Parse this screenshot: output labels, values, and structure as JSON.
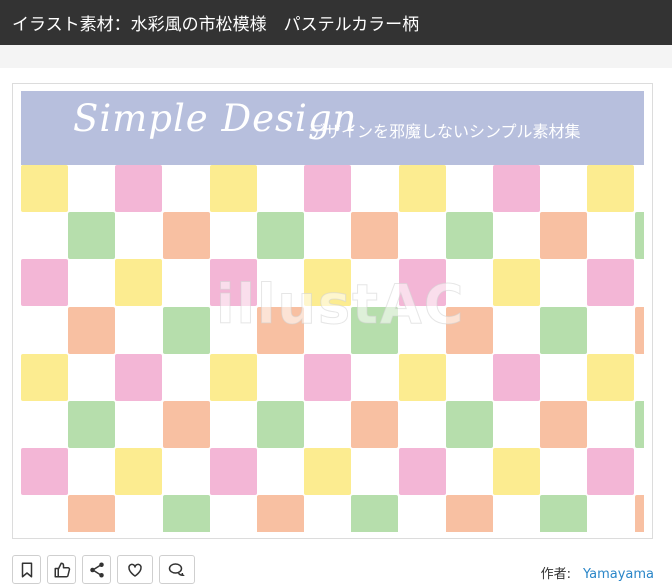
{
  "header": {
    "title": "イラスト素材：水彩風の市松模様　パステルカラー柄"
  },
  "artwork": {
    "banner_title": "Simple Design",
    "banner_subtitle": "デザインを邪魔しないシンプル素材集",
    "banner_color": "#b7bfdd",
    "watermark": "illustAC",
    "palette": {
      "yellow": "#fbe97c",
      "pink": "#f1a9cf",
      "green": "#a9d89e",
      "orange": "#f7b592"
    }
  },
  "actions": {
    "icons": [
      "bookmark-icon",
      "thumbs-up-icon",
      "share-icon",
      "heart-icon",
      "comment-icon"
    ]
  },
  "author": {
    "label": "作者:",
    "name": "Yamayama"
  }
}
